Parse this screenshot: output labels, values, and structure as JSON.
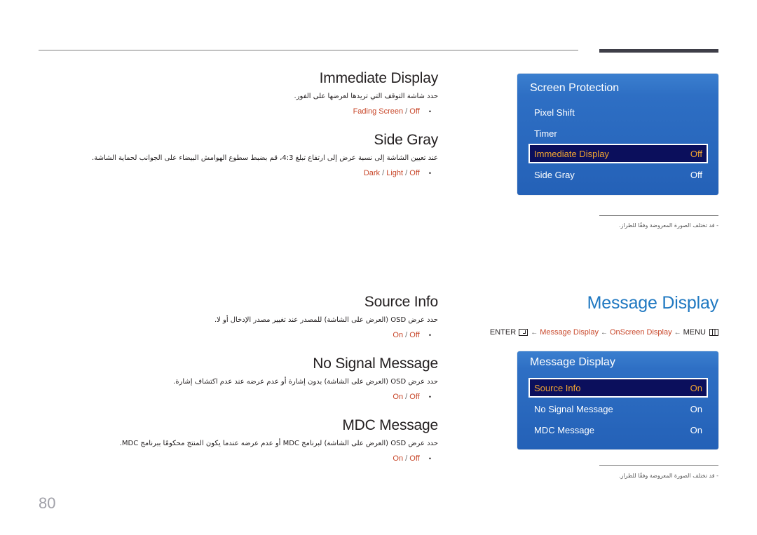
{
  "page": {
    "number": "80"
  },
  "sections": [
    {
      "title": "Immediate Display",
      "description": "حدد شاشة التوقف التي تريدها لعرضها على الفور.",
      "options": [
        "Fading Screen",
        "Off"
      ]
    },
    {
      "title": "Side Gray",
      "description": "عند تعيين الشاشة إلى نسبة عرض إلى ارتفاع تبلغ 4:3، قم بضبط سطوع الهوامش البيضاء على الجوانب لحماية الشاشة.",
      "options": [
        "Dark",
        "Light",
        "Off"
      ]
    },
    {
      "title": "Source Info",
      "description": "حدد عرض OSD (العرض على الشاشة) للمصدر عند تغيير مصدر الإدخال أو لا.",
      "options": [
        "On",
        "Off"
      ]
    },
    {
      "title": "No Signal Message",
      "description": "حدد عرض OSD (العرض على الشاشة) بدون إشارة أو عدم عرضه عند عدم اكتشاف إشارة.",
      "options": [
        "On",
        "Off"
      ]
    },
    {
      "title": "MDC Message",
      "description": "حدد عرض OSD (العرض على الشاشة) لبرنامج MDC أو عدم عرضه عندما يكون المنتج محكومًا ببرنامج MDC.",
      "options": [
        "On",
        "Off"
      ]
    }
  ],
  "option_separator": "/",
  "bullet": "•",
  "screen_protection_osd": {
    "title": "Screen Protection",
    "items": [
      {
        "label": "Pixel Shift",
        "value": "",
        "selected": false
      },
      {
        "label": "Timer",
        "value": "",
        "selected": false
      },
      {
        "label": "Immediate Display",
        "value": "Off",
        "selected": true
      },
      {
        "label": "Side Gray",
        "value": "Off",
        "selected": false
      }
    ]
  },
  "message_display_heading": "Message Display",
  "breadcrumb": {
    "enter": "ENTER",
    "arrow": "←",
    "path": [
      "Message Display",
      "OnScreen Display"
    ],
    "menu": "MENU"
  },
  "message_display_osd": {
    "title": "Message Display",
    "items": [
      {
        "label": "Source Info",
        "value": "On",
        "selected": true
      },
      {
        "label": "No Signal Message",
        "value": "On",
        "selected": false
      },
      {
        "label": "MDC Message",
        "value": "On",
        "selected": false
      }
    ]
  },
  "notes": {
    "image_may_differ": "-  قد تختلف الصورة المعروضة وفقًا للطراز."
  },
  "colors": {
    "accent_orange": "#c8472a",
    "heading_blue": "#1f78c1",
    "osd_blue": "#2461b7",
    "osd_selected_bg": "#0b0f5c",
    "osd_selected_text": "#f0a431"
  }
}
